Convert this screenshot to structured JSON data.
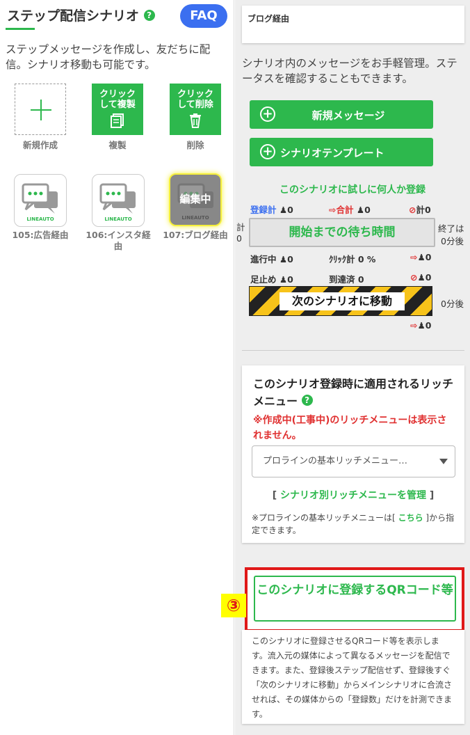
{
  "left": {
    "title": "ステップ配信シナリオ",
    "help": "?",
    "faq": "FAQ",
    "description": "ステップメッセージを作成し、友だちに配信。シナリオ移動も可能です。",
    "actions": {
      "new_label": "新規作成",
      "copy_tile": "クリックして複製",
      "copy_label": "複製",
      "delete_tile": "クリックして削除",
      "delete_label": "削除"
    },
    "scenarios": [
      {
        "caption": "105:広告経由",
        "brand": "LINEAUTO"
      },
      {
        "caption": "106:インスタ経由",
        "brand": "LINEAUTO"
      },
      {
        "caption": "107:ブログ経由",
        "brand": "LINEAUTO",
        "overlay": "編集中"
      }
    ]
  },
  "right": {
    "scenario_name": "ブログ経由",
    "description": "シナリオ内のメッセージをお手軽管理。ステータスを確認することもできます。",
    "new_message_button": "新規メッセージ",
    "template_button": "シナリオテンプレート",
    "try_register": "このシナリオに試しに何人か登録",
    "stats": {
      "registered_label": "登録計",
      "registered_value": "0",
      "total_label": "合計",
      "total_value": "0",
      "blocked_total_label": "計",
      "blocked_total_value": "0",
      "left_side_label": "計",
      "left_side_value": "0",
      "wait_button": "開始までの待ち時間",
      "end_label": "終了は",
      "end_time_1": "0分後",
      "in_progress_label": "進行中",
      "in_progress_value": "0",
      "click_label": "ｸﾘｯｸ計",
      "click_value": "0 %",
      "exit_1_value": "0",
      "stopped_label": "足止め",
      "stopped_value": "0",
      "reached_label": "到達済",
      "reached_value": "0",
      "blocked_value": "0",
      "move_button": "次のシナリオに移動",
      "end_time_2": "0分後",
      "exit_2_value": "0"
    },
    "rich_menu": {
      "title": "このシナリオ登録時に適用されるリッチメニュー",
      "warning": "※作成中(工事中)のリッチメニューは表示されません。",
      "select_value": "プロラインの基本リッチメニュー…",
      "manage_open": "[",
      "manage_label": "シナリオ別リッチメニューを管理",
      "manage_close": "]",
      "note_before": "※プロラインの基本リッチメニューは[",
      "note_link": "こちら",
      "note_after": "]から指定できます。"
    },
    "qr": {
      "marker": "③",
      "button": "このシナリオに登録するQRコード等",
      "description": "このシナリオに登録させるQRコード等を表示します。流入元の媒体によって異なるメッセージを配信できます。また、登録後ステップ配信せず、登録後すぐ「次のシナリオに移動」からメインシナリオに合流させれば、その媒体からの「登録数」だけを計測できます。"
    },
    "colors": {
      "accent": "#2db84d",
      "faq": "#3b6ff0",
      "warning": "#e03030",
      "highlight": "#e01818"
    }
  }
}
